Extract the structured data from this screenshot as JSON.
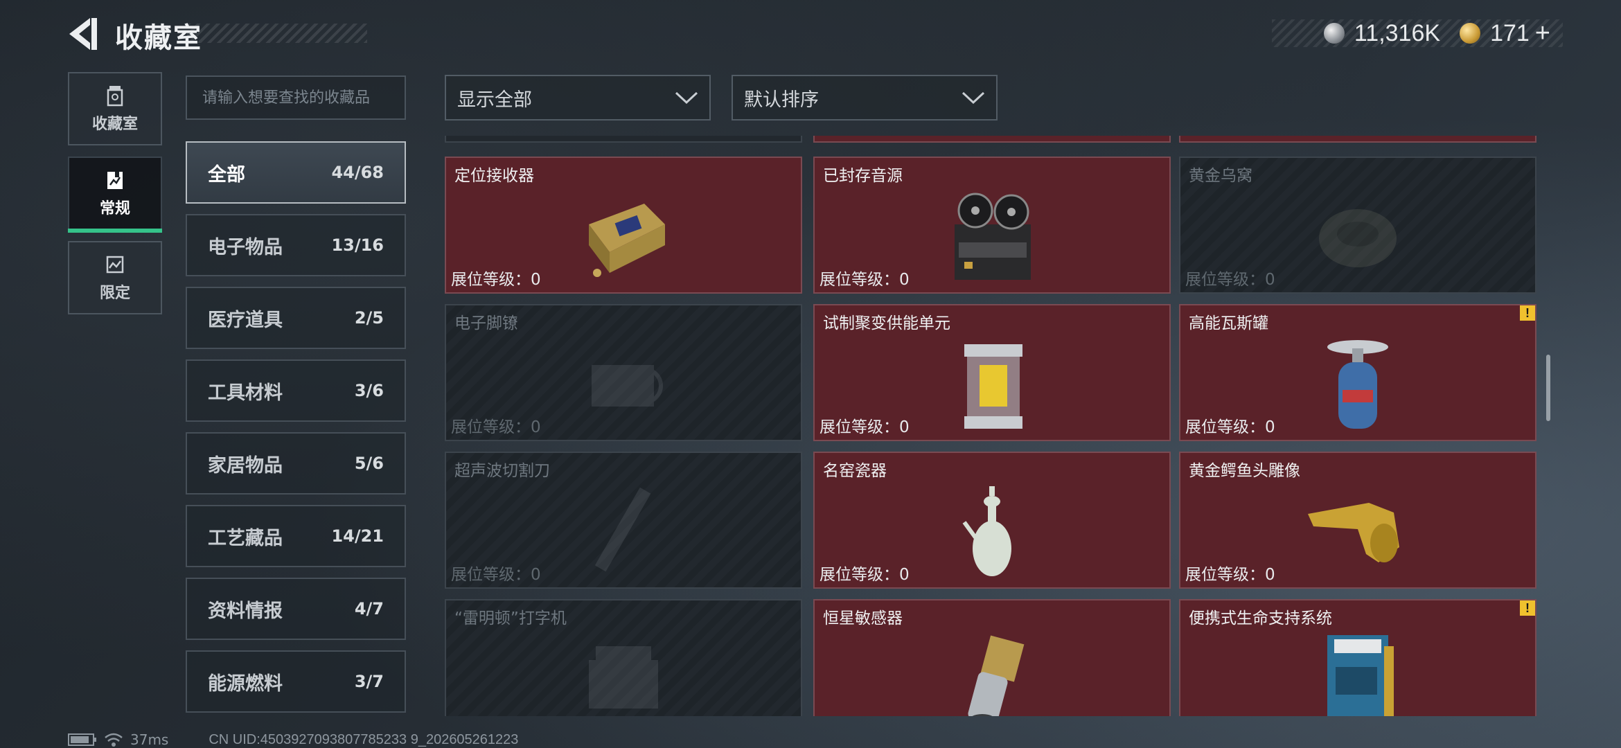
{
  "header": {
    "title": "收藏室",
    "currency": [
      {
        "icon": "silver-coin-icon",
        "value": "11,316K"
      },
      {
        "icon": "gold-coin-icon",
        "value": "171"
      }
    ],
    "add_label": "+"
  },
  "nav": [
    {
      "label": "收藏室",
      "icon": "collection-room-icon",
      "active": false
    },
    {
      "label": "常规",
      "icon": "regular-album-icon",
      "active": true
    },
    {
      "label": "限定",
      "icon": "limited-album-icon",
      "active": false
    }
  ],
  "search": {
    "placeholder": "请输入想要查找的收藏品"
  },
  "filters": {
    "display": "显示全部",
    "sort": "默认排序"
  },
  "categories": [
    {
      "name": "全部",
      "count": "44/68",
      "active": true
    },
    {
      "name": "电子物品",
      "count": "13/16"
    },
    {
      "name": "医疗道具",
      "count": "2/5"
    },
    {
      "name": "工具材料",
      "count": "3/6"
    },
    {
      "name": "家居物品",
      "count": "5/6"
    },
    {
      "name": "工艺藏品",
      "count": "14/21"
    },
    {
      "name": "资料情报",
      "count": "4/7"
    },
    {
      "name": "能源燃料",
      "count": "3/7"
    }
  ],
  "items": [
    {
      "name": "定位接收器",
      "level": "展位等级：0",
      "owned": true,
      "icon": "locator-receiver-icon"
    },
    {
      "name": "已封存音源",
      "level": "展位等级：0",
      "owned": true,
      "icon": "reel-recorder-icon"
    },
    {
      "name": "黄金乌窝",
      "level": "展位等级：0",
      "owned": false,
      "icon": "golden-nest-icon"
    },
    {
      "name": "电子脚镣",
      "level": "展位等级：0",
      "owned": false,
      "icon": "electronic-shackle-icon"
    },
    {
      "name": "试制聚变供能单元",
      "level": "展位等级：0",
      "owned": true,
      "icon": "fusion-power-unit-icon"
    },
    {
      "name": "高能瓦斯罐",
      "level": "展位等级：0",
      "owned": true,
      "icon": "gas-canister-icon",
      "alert": "!"
    },
    {
      "name": "超声波切割刀",
      "level": "展位等级：0",
      "owned": false,
      "icon": "ultrasonic-cutter-icon"
    },
    {
      "name": "名窑瓷器",
      "level": "展位等级：0",
      "owned": true,
      "icon": "porcelain-ewer-icon"
    },
    {
      "name": "黄金鳄鱼头雕像",
      "level": "展位等级：0",
      "owned": true,
      "icon": "golden-crocodile-head-icon"
    },
    {
      "name": "“雷明顿”打字机",
      "level": "",
      "owned": false,
      "icon": "typewriter-icon"
    },
    {
      "name": "恒星敏感器",
      "level": "",
      "owned": true,
      "icon": "star-sensor-icon"
    },
    {
      "name": "便携式生命支持系统",
      "level": "",
      "owned": true,
      "icon": "life-support-system-icon",
      "alert": "!"
    }
  ],
  "status": {
    "ping": "37ms",
    "uid": "CN UID:4503927093807785233 9_202605261223"
  }
}
